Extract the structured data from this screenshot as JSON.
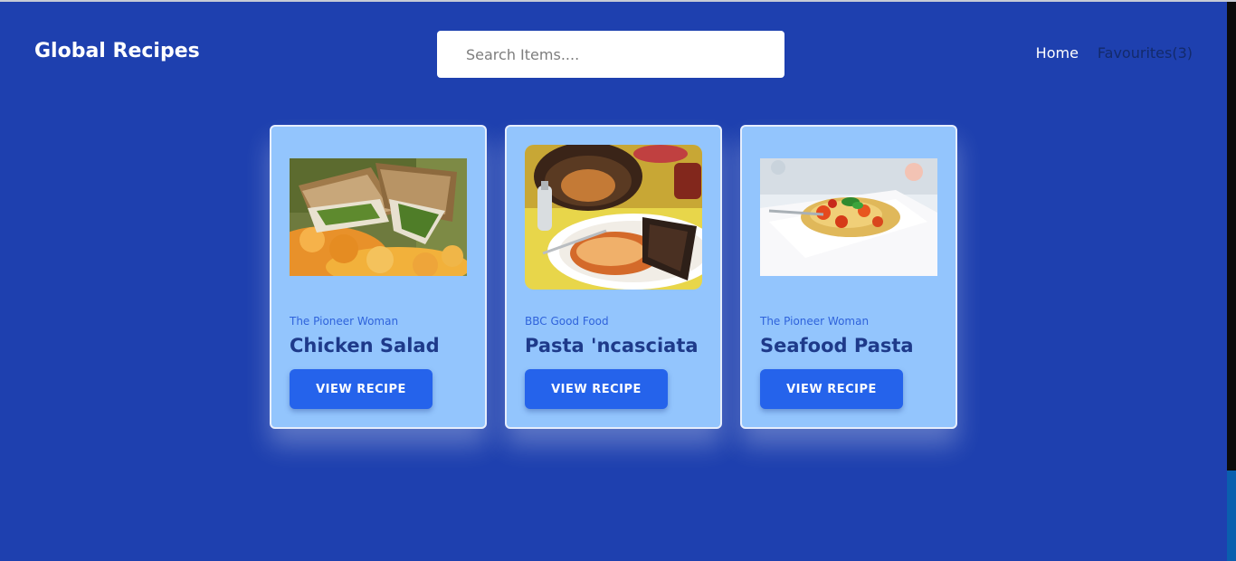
{
  "header": {
    "brand": "Global Recipes",
    "search_placeholder": "Search Items....",
    "nav": {
      "home": "Home",
      "favourites": "Favourites(3)"
    }
  },
  "recipes": [
    {
      "source": "The Pioneer Woman",
      "title": "Chicken Salad",
      "button": "VIEW RECIPE",
      "image_icon": "sandwich-photo"
    },
    {
      "source": "BBC Good Food",
      "title": "Pasta 'ncasciata",
      "button": "VIEW RECIPE",
      "image_icon": "pasta-bake-photo"
    },
    {
      "source": "The Pioneer Woman",
      "title": "Seafood Pasta",
      "button": "VIEW RECIPE",
      "image_icon": "seafood-pasta-photo"
    }
  ],
  "colors": {
    "background": "#1e40af",
    "card": "#93c5fd",
    "button": "#2563eb",
    "title": "#1e3a8a",
    "source": "#2f63db"
  }
}
